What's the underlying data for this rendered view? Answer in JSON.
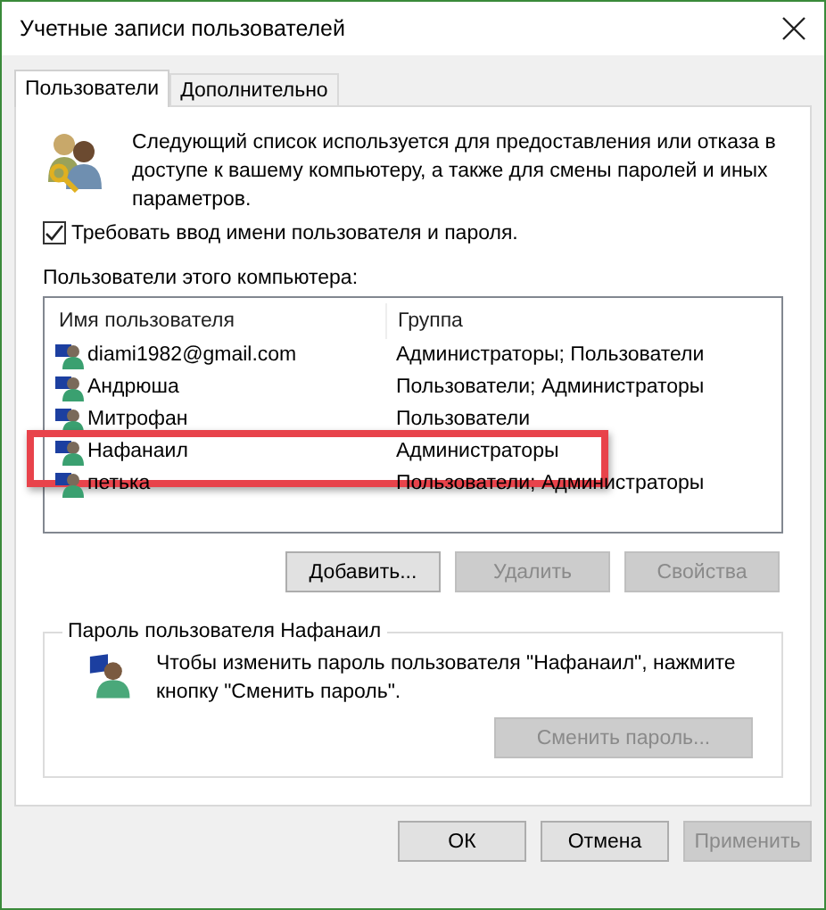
{
  "window": {
    "title": "Учетные записи пользователей"
  },
  "tabs": [
    {
      "label": "Пользователи",
      "selected": true
    },
    {
      "label": "Дополнительно",
      "selected": false
    }
  ],
  "intro": "Следующий список используется для предоставления или отказа в доступе к вашему компьютеру, а также для смены паролей и иных параметров.",
  "require_login": {
    "label": "Требовать ввод имени пользователя и пароля.",
    "checked": true
  },
  "users_label": "Пользователи этого компьютера:",
  "table": {
    "columns": [
      "Имя пользователя",
      "Группа"
    ],
    "rows": [
      {
        "name": "diami1982@gmail.com",
        "group": "Администраторы; Пользователи",
        "highlighted": false
      },
      {
        "name": "Андрюша",
        "group": "Пользователи; Администраторы",
        "highlighted": false
      },
      {
        "name": "Митрофан",
        "group": "Пользователи",
        "highlighted": false
      },
      {
        "name": "Нафанаил",
        "group": "Администраторы",
        "highlighted": true
      },
      {
        "name": "петька",
        "group": "Пользователи; Администраторы",
        "highlighted": false
      }
    ]
  },
  "list_buttons": [
    {
      "label": "Добавить...",
      "disabled": false
    },
    {
      "label": "Удалить",
      "disabled": true
    },
    {
      "label": "Свойства",
      "disabled": true
    }
  ],
  "password_group": {
    "title": "Пароль пользователя Нафанаил",
    "text": "Чтобы изменить пароль пользователя \"Нафанаил\", нажмите кнопку \"Сменить пароль\".",
    "button": {
      "label": "Сменить пароль...",
      "disabled": true
    }
  },
  "dialog_buttons": [
    {
      "label": "ОК",
      "disabled": false
    },
    {
      "label": "Отмена",
      "disabled": false
    },
    {
      "label": "Применить",
      "disabled": true
    }
  ]
}
